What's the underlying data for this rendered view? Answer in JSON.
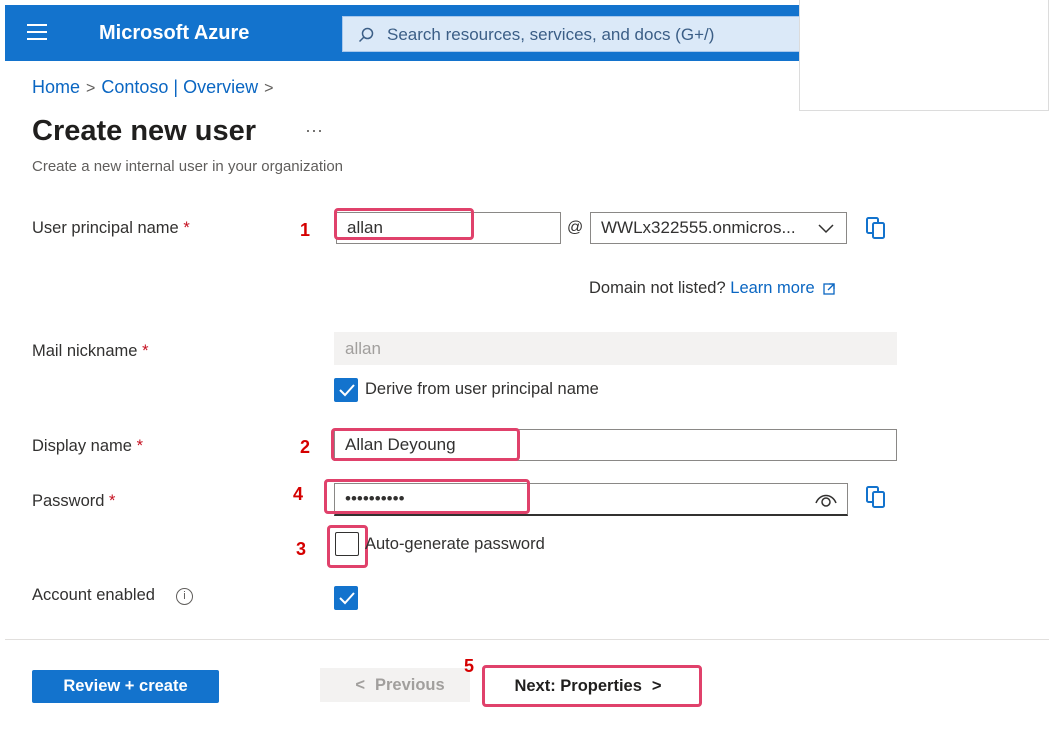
{
  "header": {
    "brand": "Microsoft Azure",
    "search_placeholder": "Search resources, services, and docs (G+/)"
  },
  "breadcrumb": {
    "home": "Home",
    "overview": "Contoso | Overview"
  },
  "page": {
    "title": "Create new user",
    "ellipsis": "···",
    "subtitle": "Create a new internal user in your organization"
  },
  "annotations": {
    "n1": "1",
    "n2": "2",
    "n3": "3",
    "n4": "4",
    "n5": "5"
  },
  "form": {
    "upn_label": "User principal name",
    "required_mark": "*",
    "upn_value": "allan",
    "at_sign": "@",
    "domain_value": "WWLx322555.onmicros...",
    "domain_help": "Domain not listed?",
    "learn_more": "Learn more",
    "mail_label": "Mail nickname",
    "mail_value": "allan",
    "derive_label": "Derive from user principal name",
    "derive_checked": true,
    "display_label": "Display name",
    "display_value": "Allan Deyoung",
    "password_label": "Password",
    "password_value": "••••••••••",
    "autogen_label": "Auto-generate password",
    "autogen_checked": false,
    "account_label": "Account enabled",
    "info_glyph": "i",
    "account_checked": true
  },
  "footer": {
    "review_label": "Review + create",
    "prev_label": "Previous",
    "next_label": "Next: Properties"
  },
  "colors": {
    "azure_blue": "#1373cd",
    "highlight": "#e0416b",
    "annotation_red": "#d50000",
    "link": "#0a66c2"
  }
}
